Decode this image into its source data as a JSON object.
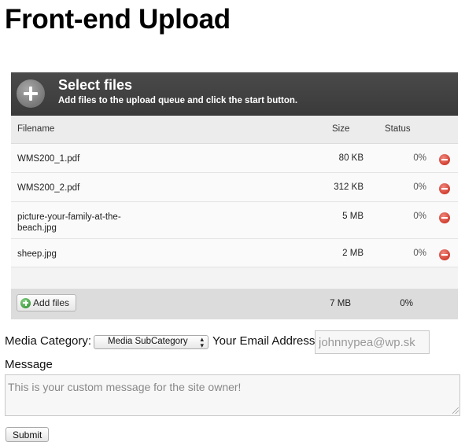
{
  "page": {
    "title": "Front-end Upload"
  },
  "uploader": {
    "header_title": "Select files",
    "header_subtitle": "Add files to the upload queue and click the start button.",
    "columns": {
      "filename": "Filename",
      "size": "Size",
      "status": "Status"
    },
    "files": [
      {
        "name": "WMS200_1.pdf",
        "size": "80 KB",
        "status": "0%"
      },
      {
        "name": "WMS200_2.pdf",
        "size": "312 KB",
        "status": "0%"
      },
      {
        "name": "picture-your-family-at-the-beach.jpg",
        "size": "5 MB",
        "status": "0%"
      },
      {
        "name": "sheep.jpg",
        "size": "2 MB",
        "status": "0%"
      }
    ],
    "add_files_label": "Add files",
    "total_size": "7 MB",
    "total_status": "0%"
  },
  "form": {
    "category_label": "Media Category:",
    "category_value": "Media SubCategory",
    "email_label": "Your Email Address",
    "email_value": "johnnypea@wp.sk",
    "message_label": "Message",
    "message_placeholder": "This is your custom message for the site owner!",
    "submit_label": "Submit"
  },
  "colors": {
    "header_bg": "#3f3f3f",
    "remove_icon": "#d0392b",
    "add_icon": "#3a9a3a"
  }
}
